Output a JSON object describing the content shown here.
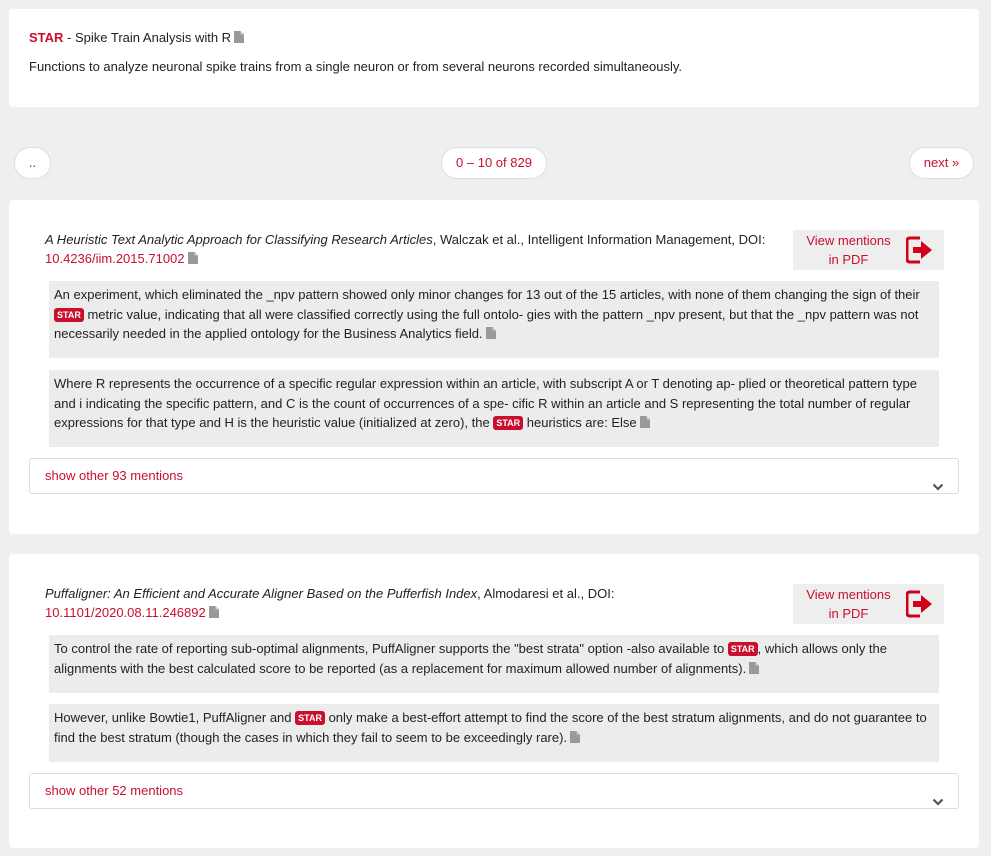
{
  "software": {
    "name": "STAR",
    "separator": " - ",
    "title": "Spike Train Analysis with R",
    "description": "Functions to analyze neuronal spike trains from a single neuron or from several neurons recorded simultaneously."
  },
  "pagination": {
    "prev": "..",
    "range": "0 – 10 of 829",
    "next": "next »"
  },
  "tag_label": "STAR",
  "papers": [
    {
      "title": "A Heuristic Text Analytic Approach for Classifying Research Articles",
      "meta": ", Walczak et al., Intelligent Information Management, DOI: ",
      "doi": "10.4236/iim.2015.71002",
      "pdf_line1": "View mentions",
      "pdf_line2": "in PDF",
      "snippets": [
        {
          "before": "An experiment, which eliminated the _npv pattern showed only minor changes for 13 out of the 15 articles, with none of them changing the sign of their ",
          "after": " metric value, indicating that all were classified correctly using the full ontolo- gies with the pattern _npv present, but that the _npv pattern was not necessarily needed in the applied ontology for the Business Analytics field."
        },
        {
          "before": "Where R represents the occurrence of a specific regular expression within an article, with subscript A or T denoting ap- plied or theoretical pattern type and i indicating the specific pattern, and C is the count of occurrences of a spe- cific R within an article and S representing the total number of regular expressions for that type and H is the heuristic value (initialized at zero), the ",
          "after": " heuristics are: Else"
        }
      ],
      "show_more": "show other 93 mentions"
    },
    {
      "title": "Puffaligner: An Efficient and Accurate Aligner Based on the Pufferfish Index",
      "meta": ", Almodaresi et al., DOI: ",
      "doi": "10.1101/2020.08.11.246892",
      "pdf_line1": "View mentions",
      "pdf_line2": "in PDF",
      "snippets": [
        {
          "before": "To control the rate of reporting sub-optimal alignments, PuffAligner supports the \"best strata\" option -also available to ",
          "after": ", which allows only the alignments with the best calculated score to be reported (as a replacement for maximum allowed number of alignments)."
        },
        {
          "before": "However, unlike Bowtie1, PuffAligner and ",
          "after": " only make a best-effort attempt to find the score of the best stratum alignments, and do not guarantee to find the best stratum (though the cases in which they fail to seem to be exceedingly rare)."
        }
      ],
      "show_more": "show other 52 mentions"
    }
  ],
  "icons": {
    "document": "document-icon",
    "pdf_export": "sign-out-icon",
    "chevron": "chevron-down-icon"
  },
  "colors": {
    "accent": "#c8102e",
    "background": "#efefef",
    "snippet_bg": "#ececec"
  }
}
